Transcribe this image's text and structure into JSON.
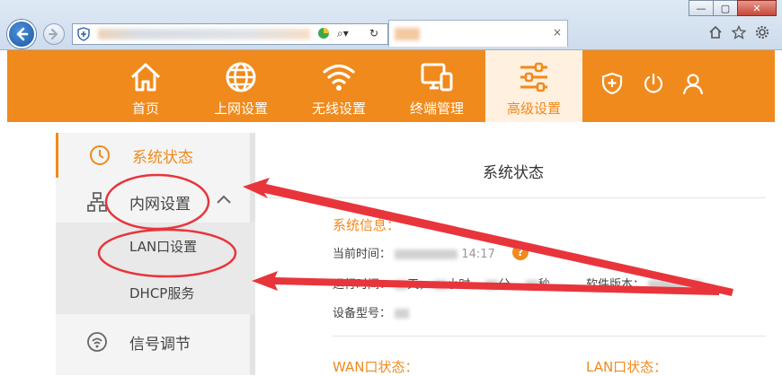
{
  "browser": {
    "window_buttons": [
      "—",
      "▢",
      "✕"
    ],
    "tab_close": "×",
    "toolbar_icons": [
      "home-icon",
      "star-icon",
      "gear-icon"
    ]
  },
  "header": {
    "nav": [
      {
        "label": "首页",
        "icon": "home-icon"
      },
      {
        "label": "上网设置",
        "icon": "globe-icon"
      },
      {
        "label": "无线设置",
        "icon": "wifi-icon"
      },
      {
        "label": "终端管理",
        "icon": "devices-icon"
      },
      {
        "label": "高级设置",
        "icon": "sliders-icon"
      }
    ],
    "active_index": 4,
    "accent": "#f08a1c"
  },
  "sidebar": {
    "items": [
      {
        "label": "系统状态",
        "icon": "clock-icon"
      },
      {
        "label": "内网设置",
        "icon": "network-icon"
      },
      {
        "label": "信号调节",
        "icon": "signal-icon"
      }
    ],
    "sub_items": [
      "LAN口设置",
      "DHCP服务"
    ]
  },
  "main": {
    "title": "系统状态",
    "system_info_title": "系统信息：",
    "current_time_label": "当前时间：",
    "current_time_value": "14:17",
    "help_mark": "?",
    "uptime_label": "运行时间：",
    "uptime_day": "天，",
    "uptime_hour": "小时，",
    "uptime_min": "分，",
    "uptime_sec": "秒",
    "software_version_label": "软件版本：",
    "device_model_label": "设备型号：",
    "wan_status_title": "WAN口状态：",
    "lan_status_title": "LAN口状态："
  }
}
